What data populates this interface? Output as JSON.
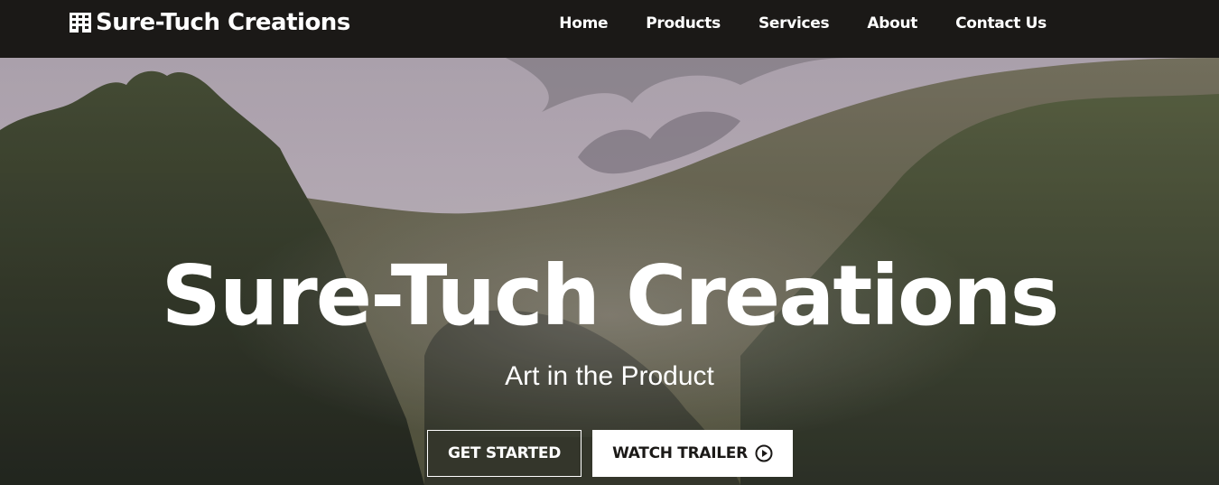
{
  "brand": {
    "name": "Sure-Tuch Creations",
    "icon": "building-icon"
  },
  "nav": {
    "items": [
      {
        "label": "Home"
      },
      {
        "label": "Products"
      },
      {
        "label": "Services"
      },
      {
        "label": "About"
      },
      {
        "label": "Contact Us"
      }
    ]
  },
  "hero": {
    "title": "Sure-Tuch Creations",
    "subtitle": "Art in the Product",
    "primary_button": "GET STARTED",
    "secondary_button": "WATCH TRAILER",
    "secondary_icon": "play-circle-icon"
  },
  "colors": {
    "nav_bg": "#1b1917",
    "text": "#ffffff",
    "button_dark_text": "#1b1917"
  }
}
